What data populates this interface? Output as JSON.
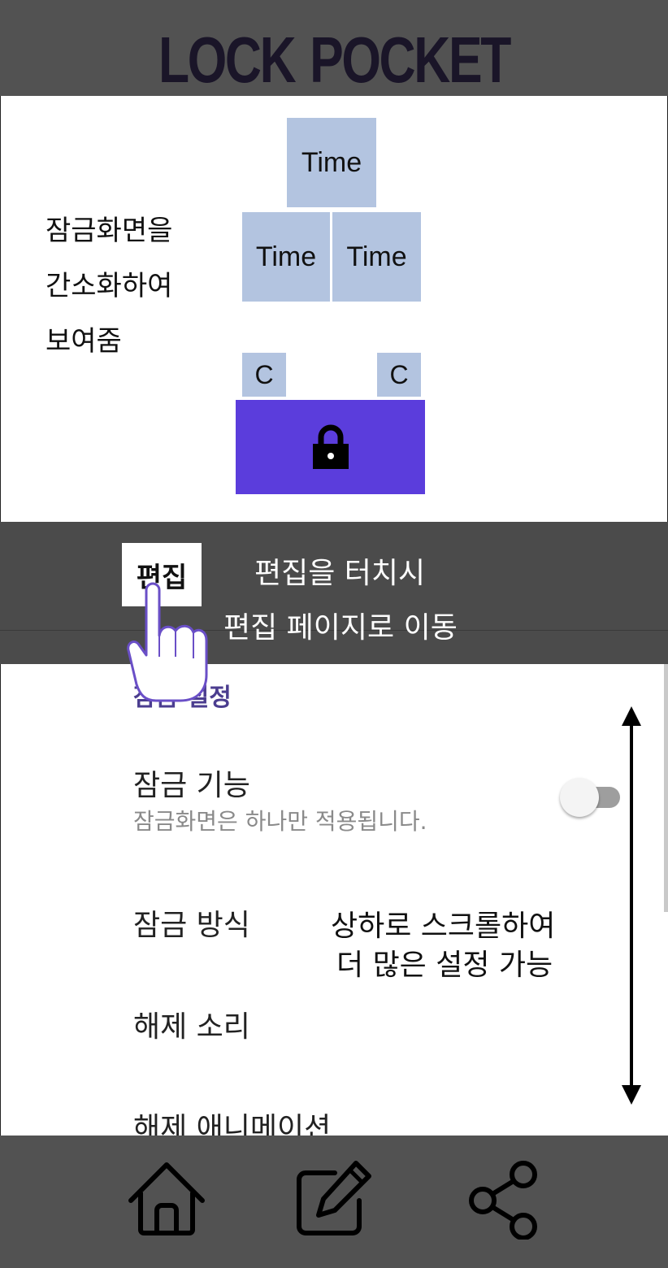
{
  "header": {
    "logo_part1": "LOCK",
    "logo_part2": "POCKET"
  },
  "preview": {
    "description_lines": [
      "잠금화면을",
      "간소화하여",
      "보여줌"
    ],
    "time_labels": [
      "Time",
      "Time",
      "Time"
    ],
    "c_labels": [
      "C",
      "C"
    ],
    "lock_icon": "lock-icon",
    "colors": {
      "widget": "#b3c4e0",
      "lock_panel": "#5b3ddc"
    }
  },
  "overlay": {
    "edit_button": "편집",
    "hint_line1": "편집을 터치시",
    "hint_line2": "편집 페이지로 이동",
    "pointer_icon": "hand-pointer-icon"
  },
  "settings": {
    "section_title": "잠금 설정",
    "items": [
      {
        "title": "잠금 기능",
        "subtitle": "잠금화면은 하나만 적용됩니다.",
        "toggle_on": false
      },
      {
        "title": "잠금 방식"
      },
      {
        "title": "해제 소리"
      },
      {
        "title": "해제 애니메이션"
      }
    ],
    "scroll_hint_line1": "상하로 스크롤하여",
    "scroll_hint_line2": "더 많은 설정 가능",
    "scroll_arrow_icon": "up-down-arrow-icon"
  },
  "bottom_nav": {
    "items": [
      {
        "icon": "home-icon"
      },
      {
        "icon": "edit-icon"
      },
      {
        "icon": "share-icon"
      }
    ]
  }
}
